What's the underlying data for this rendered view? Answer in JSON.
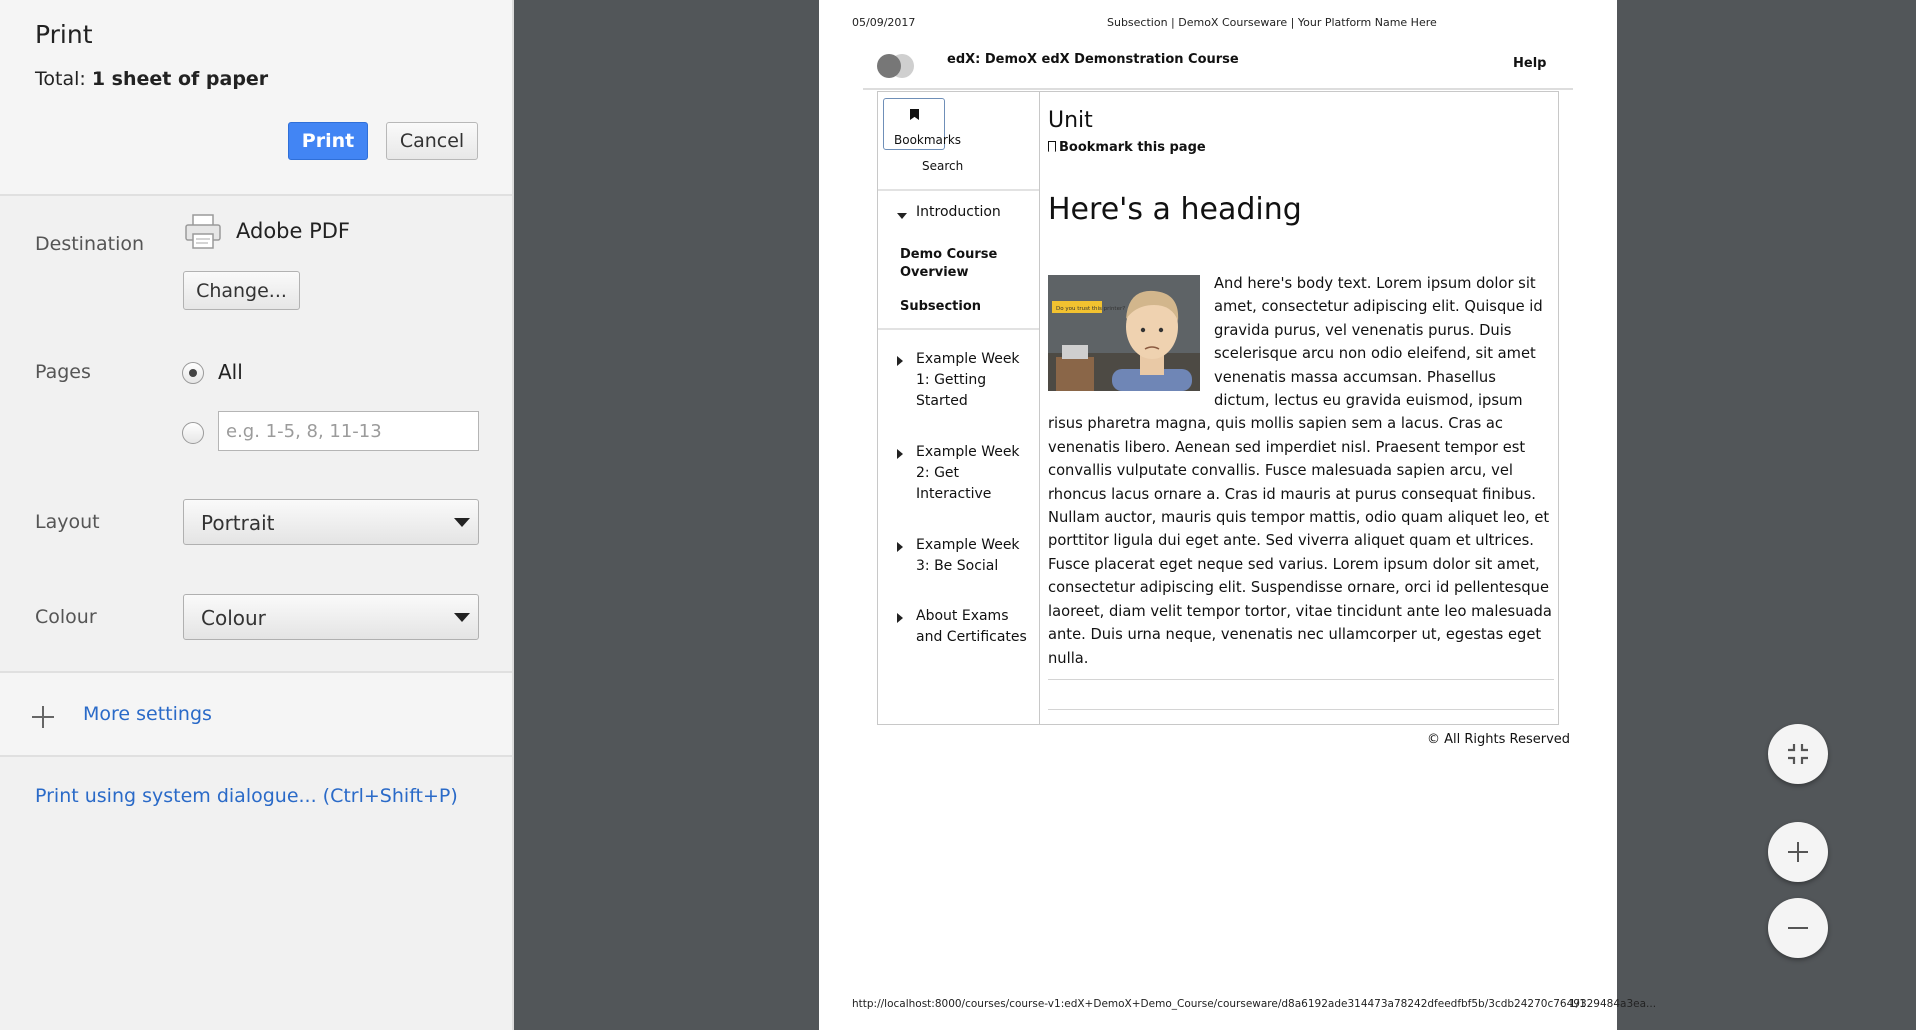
{
  "dialog": {
    "title": "Print",
    "total_label": "Total:",
    "total_value": "1 sheet of paper",
    "print_button": "Print",
    "cancel_button": "Cancel"
  },
  "destination": {
    "label": "Destination",
    "name": "Adobe PDF",
    "change_button": "Change..."
  },
  "pages": {
    "label": "Pages",
    "all_label": "All",
    "custom_placeholder": "e.g. 1-5, 8, 11-13"
  },
  "layout": {
    "label": "Layout",
    "value": "Portrait"
  },
  "colour": {
    "label": "Colour",
    "value": "Colour"
  },
  "more_settings": "More settings",
  "system_dialog_link": "Print using system dialogue... (Ctrl+Shift+P)",
  "preview": {
    "date": "05/09/2017",
    "header_title": "Subsection | DemoX Courseware | Your Platform Name Here",
    "course_title": "edX: DemoX edX Demonstration Course",
    "help": "Help",
    "bookmarks": "Bookmarks",
    "search": "Search",
    "nav": {
      "introduction": "Introduction",
      "demo_overview": "Demo Course Overview",
      "subsection": "Subsection",
      "week1": "Example Week 1: Getting Started",
      "week2": "Example Week 2: Get Interactive",
      "week3": "Example Week 3: Be Social",
      "exams": "About Exams and Certificates"
    },
    "unit_title": "Unit",
    "bookmark_page": "Bookmark this page",
    "heading": "Here's a heading",
    "thumb_caption": "Do you trust this printer?",
    "body": "And here's body text. Lorem ipsum dolor sit amet, consectetur adipiscing elit. Quisque id gravida purus, vel venenatis purus. Duis scelerisque arcu non odio eleifend, sit amet venenatis massa accumsan. Phasellus dictum, lectus eu gravida euismod, ipsum risus pharetra magna, quis mollis sapien sem a lacus. Cras ac venenatis libero. Aenean sed imperdiet nisl. Praesent tempor est convallis vulputate convallis. Fusce malesuada sapien arcu, vel rhoncus lacus ornare a. Cras id mauris at purus consequat finibus. Nullam auctor, mauris quis tempor mattis, odio quam aliquet leo, et porttitor ligula dui eget ante. Sed viverra aliquet quam et ultrices. Fusce placerat eget neque sed varius. Lorem ipsum dolor sit amet, consectetur adipiscing elit. Suspendisse ornare, orci id pellentesque laoreet, diam velit tempor tortor, vitae tincidunt ante leo malesuada ante. Duis urna neque, venenatis nec ullamcorper ut, egestas eget nulla.",
    "rights": "© All Rights Reserved",
    "url": "http://localhost:8000/courses/course-v1:edX+DemoX+Demo_Course/courseware/d8a6192ade314473a78242dfeedfbf5b/3cdb24270c7649329484a3ea...",
    "page_num": "1/1"
  },
  "icons": {
    "printer": "printer-icon",
    "plus": "plus-icon",
    "fit": "fit-to-page-icon",
    "zoom_in": "zoom-in-icon",
    "zoom_out": "zoom-out-icon"
  },
  "colors": {
    "accent": "#4285f4",
    "link": "#2a6ac8",
    "viewer_bg": "#525659"
  }
}
